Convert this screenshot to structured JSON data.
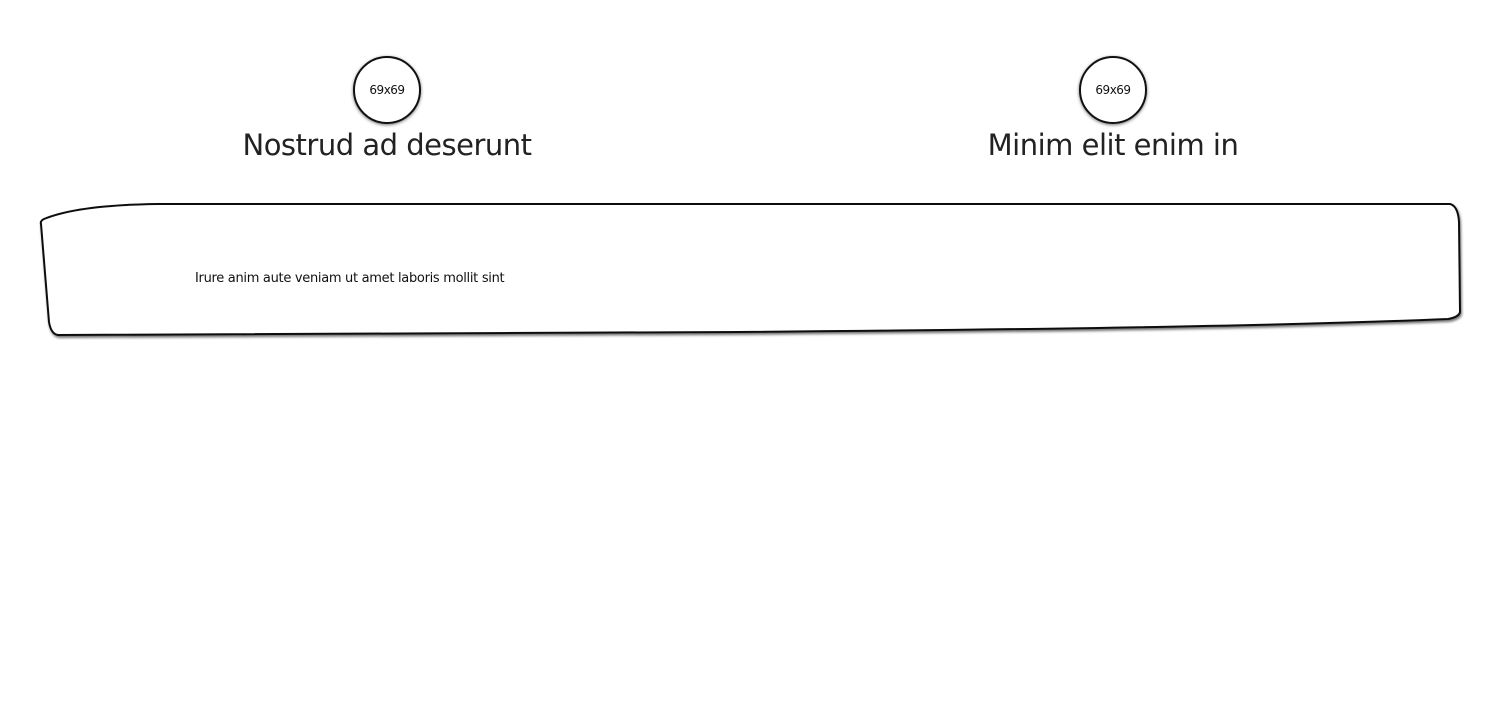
{
  "features": [
    {
      "avatar_label": "69x69",
      "title": "Nostrud ad deserunt"
    },
    {
      "avatar_label": "69x69",
      "title": "Minim elit enim in"
    }
  ],
  "banner": {
    "text": "Irure anim aute veniam ut amet laboris mollit sint"
  }
}
